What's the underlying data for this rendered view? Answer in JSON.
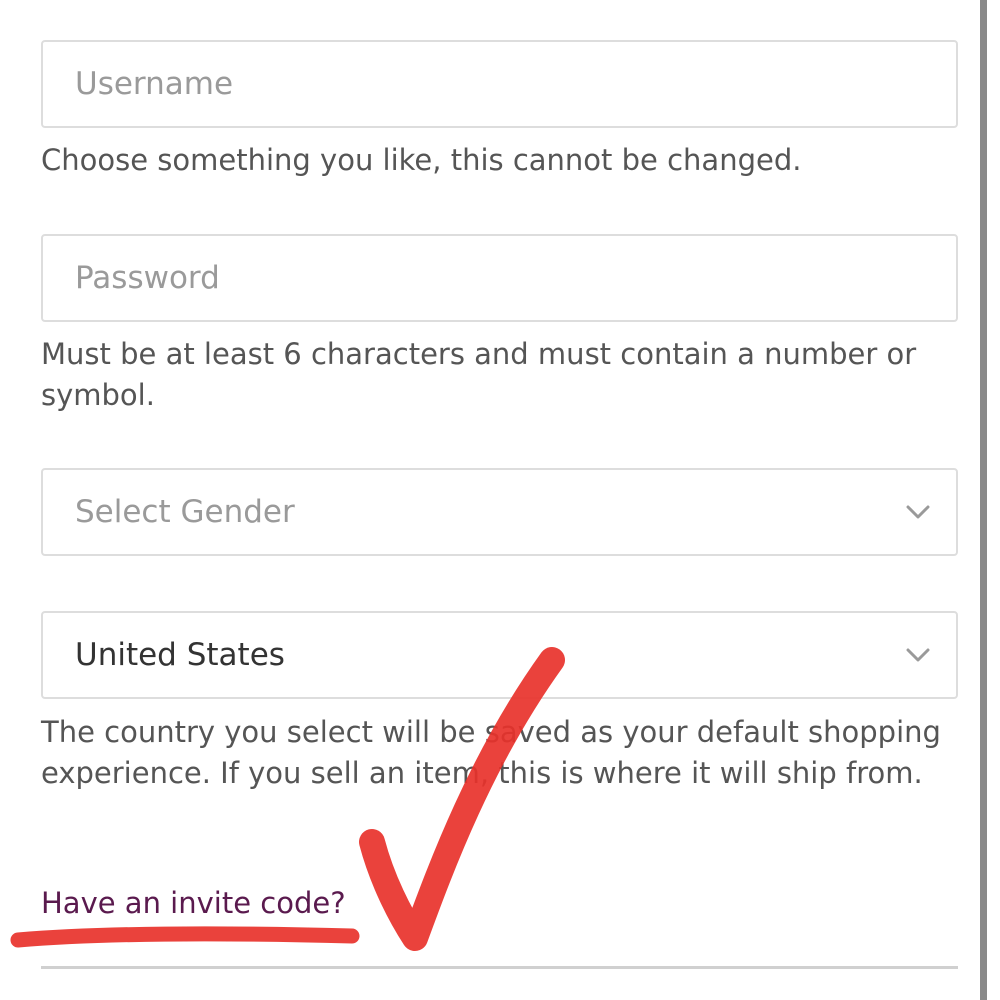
{
  "form": {
    "username": {
      "placeholder": "Username",
      "helper": "Choose something you like, this cannot be changed."
    },
    "password": {
      "placeholder": "Password",
      "helper": "Must be at least 6 characters and must contain a number or symbol."
    },
    "gender": {
      "selected": "Select Gender",
      "icon": "chevron-down-icon"
    },
    "country": {
      "selected": "United States",
      "icon": "chevron-down-icon",
      "helper": "The country you select will be saved as your default shopping experience. If you sell an item, this is where it will ship from."
    },
    "invite_link": "Have an invite code?"
  },
  "annotation": {
    "type": "checkmark-and-underline",
    "color": "#e8322b"
  },
  "colors": {
    "link": "#5a1a4e",
    "border": "#dddddd",
    "placeholder": "#9a9a9a",
    "helper_text": "#555555"
  }
}
